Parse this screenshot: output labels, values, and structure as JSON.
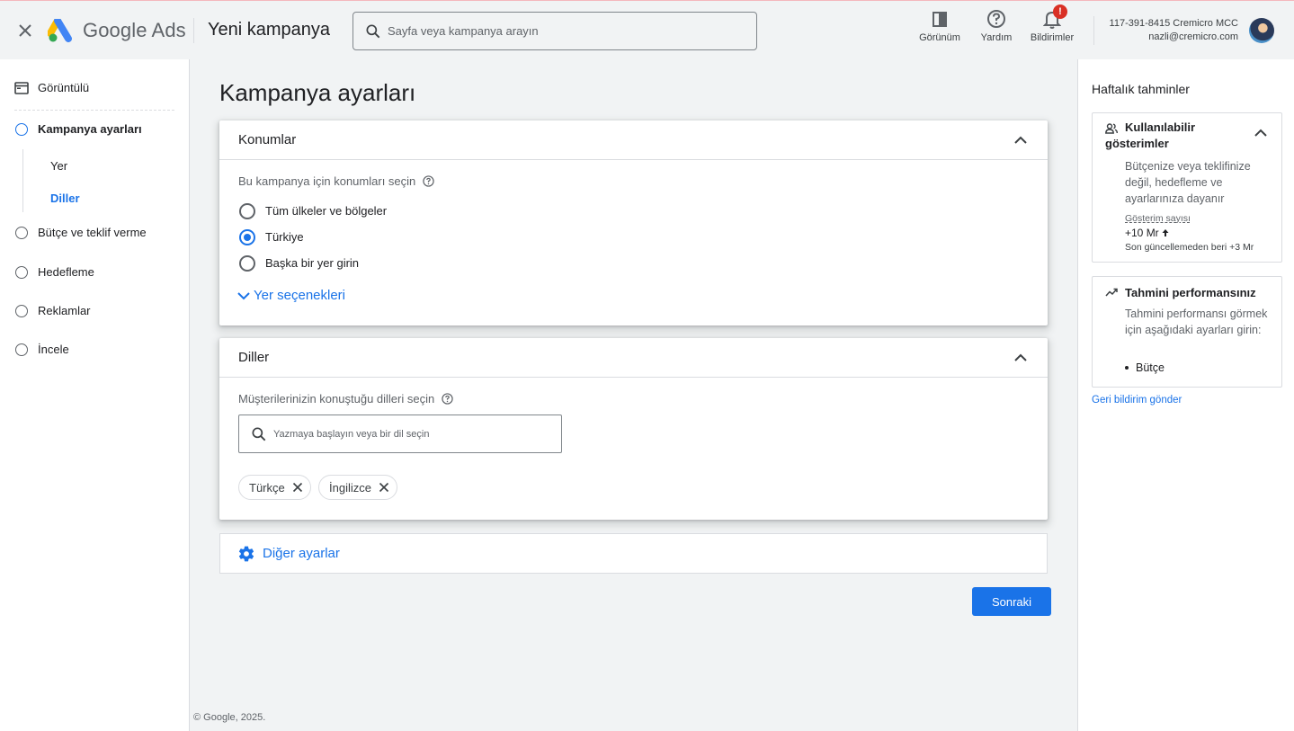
{
  "header": {
    "close_label": "✕",
    "logo_text": "Google Ads",
    "page_title": "Yeni kampanya",
    "search_placeholder": "Sayfa veya kampanya arayın",
    "view_label": "Görünüm",
    "help_label": "Yardım",
    "notifications_label": "Bildirimler",
    "notification_badge": "!",
    "account_line1": "117-391-8415 Cremicro MCC",
    "account_line2": "nazli@cremicro.com"
  },
  "sidebar": {
    "display_label": "Görüntülü",
    "items": [
      {
        "label": "Kampanya ayarları"
      },
      {
        "label": "Bütçe ve teklif verme"
      },
      {
        "label": "Hedefleme"
      },
      {
        "label": "Reklamlar"
      },
      {
        "label": "İncele"
      }
    ],
    "sub_items": [
      {
        "label": "Yer"
      },
      {
        "label": "Diller"
      }
    ]
  },
  "main": {
    "title": "Kampanya ayarları",
    "locations": {
      "header": "Konumlar",
      "prompt": "Bu kampanya için konumları seçin",
      "options": [
        {
          "label": "Tüm ülkeler ve bölgeler",
          "selected": false
        },
        {
          "label": "Türkiye",
          "selected": true
        },
        {
          "label": "Başka bir yer girin",
          "selected": false
        }
      ],
      "more_link": "Yer seçenekleri"
    },
    "languages": {
      "header": "Diller",
      "prompt": "Müşterilerinizin konuştuğu dilleri seçin",
      "search_placeholder": "Yazmaya başlayın veya bir dil seçin",
      "chips": [
        {
          "label": "Türkçe"
        },
        {
          "label": "İngilizce"
        }
      ]
    },
    "other_settings": "Diğer ayarlar",
    "next_button": "Sonraki",
    "copyright": "© Google, 2025."
  },
  "right_panel": {
    "title": "Haftalık tahminler",
    "impressions": {
      "title": "Kullanılabilir gösterimler",
      "desc": "Bütçenize veya teklifinize değil, hedefleme ve ayarlarınıza dayanır",
      "metric_label": "Gösterim sayısı",
      "metric_value": "+10 Mr",
      "metric_note": "Son güncellemeden beri +3 Mr"
    },
    "performance": {
      "title": "Tahmini performansınız",
      "desc": "Tahmini performansı görmek için aşağıdaki ayarları girin:",
      "bullet": "Bütçe"
    },
    "feedback_link": "Geri bildirim gönder"
  },
  "colors": {
    "accent": "#1a73e8",
    "badge": "#d93025",
    "background": "#f1f3f4"
  },
  "icons": [
    "close-icon",
    "google-ads-logo",
    "search-icon",
    "view-icon",
    "help-icon",
    "bell-icon",
    "display-icon",
    "chevron-up-icon",
    "chevron-down-icon",
    "question-icon",
    "gear-icon",
    "chip-close-icon",
    "people-icon",
    "trend-icon",
    "arrow-up-icon"
  ]
}
